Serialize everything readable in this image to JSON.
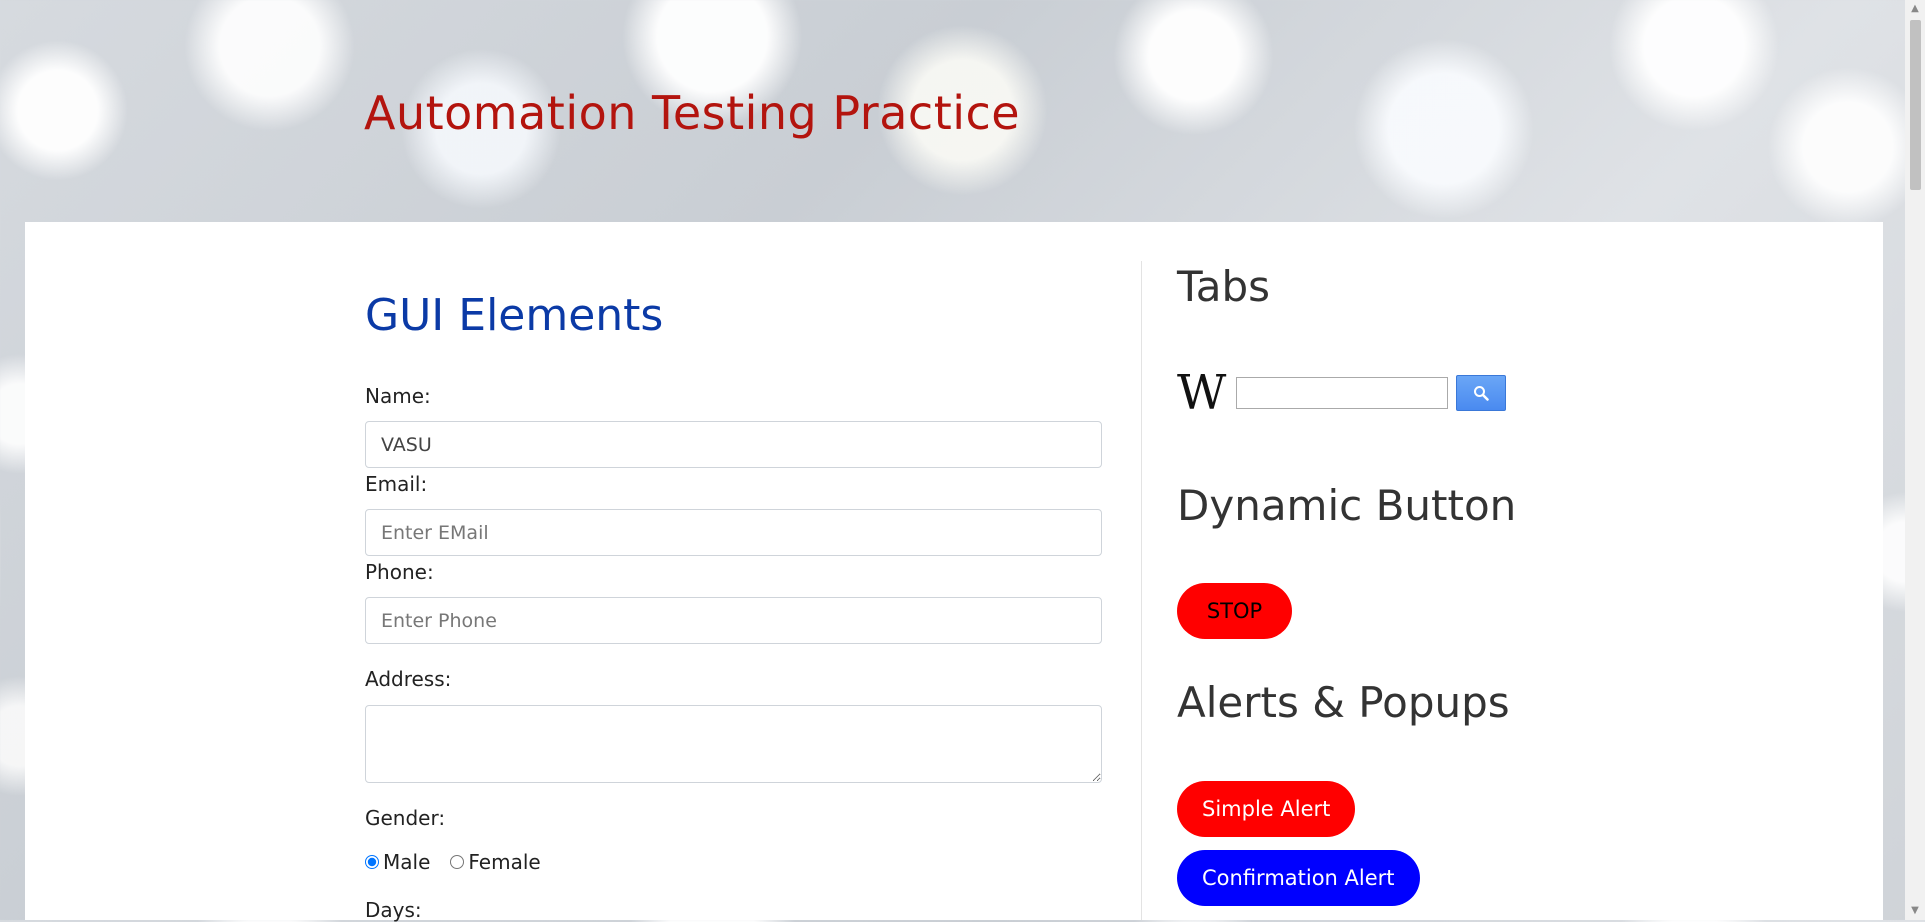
{
  "header": {
    "title": "Automation Testing Practice"
  },
  "gui": {
    "title": "GUI Elements",
    "name_label": "Name:",
    "name_value": "VASU",
    "email_label": "Email:",
    "email_placeholder": "Enter EMail",
    "phone_label": "Phone:",
    "phone_placeholder": "Enter Phone",
    "address_label": "Address:",
    "gender_label": "Gender:",
    "gender_options": [
      "Male",
      "Female"
    ],
    "gender_selected": "Male",
    "days_label": "Days:"
  },
  "tabs": {
    "title": "Tabs",
    "wiki_logo": "W"
  },
  "dynamic": {
    "title": "Dynamic Button",
    "button": "STOP"
  },
  "alerts": {
    "title": "Alerts & Popups",
    "simple": "Simple Alert",
    "confirmation": "Confirmation Alert"
  },
  "colors": {
    "title_red": "#b3140e",
    "gui_blue": "#0b3aa6",
    "stop_red": "#ff0000",
    "confirm_blue": "#0000ff"
  }
}
